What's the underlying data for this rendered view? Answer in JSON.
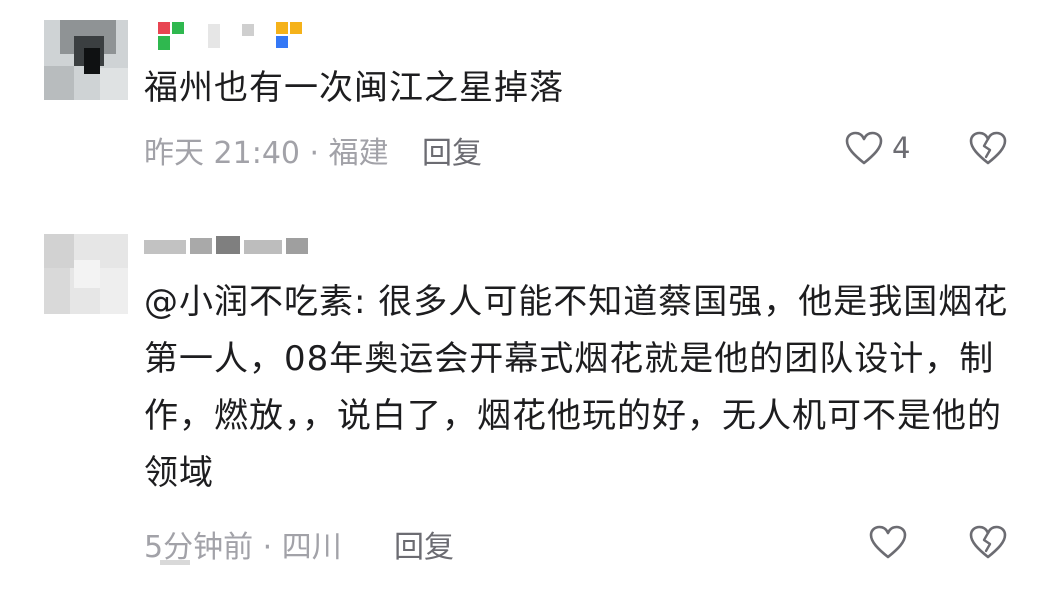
{
  "comments": [
    {
      "text": "福州也有一次闽江之星掉落",
      "time": "昨天 21:40",
      "location": "福建",
      "reply_label": "回复",
      "like_count": "4"
    },
    {
      "text": "@小润不吃素: 很多人可能不知道蔡国强，他是我国烟花第一人，08年奥运会开幕式烟花就是他的团队设计，制作，燃放，，说白了，烟花他玩的好，无人机可不是他的领域",
      "time": "5分钟前",
      "location": "四川",
      "reply_label": "回复",
      "like_count": ""
    }
  ],
  "meta_separator": " · ",
  "colors": {
    "text": "#1d1d1f",
    "meta": "#a2a2a8",
    "reply": "#6c6c72",
    "icon": "#6c6c72"
  },
  "icons": [
    "heart-outline-icon",
    "broken-heart-icon"
  ]
}
